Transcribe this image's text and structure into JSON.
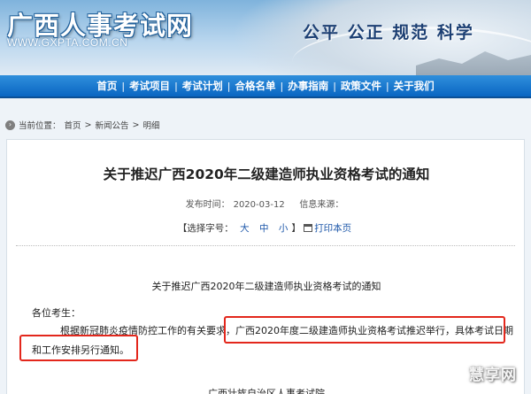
{
  "header": {
    "site_title": "广西人事考试网",
    "site_url": "WWW.GXPTA.COM.CN",
    "slogan": "公平 公正 规范 科学"
  },
  "nav": {
    "items": [
      {
        "label": "首页"
      },
      {
        "label": "考试项目"
      },
      {
        "label": "考试计划"
      },
      {
        "label": "合格名单"
      },
      {
        "label": "办事指南"
      },
      {
        "label": "政策文件"
      },
      {
        "label": "关于我们"
      }
    ],
    "separator": "|"
  },
  "breadcrumb": {
    "prefix": "当前位置：",
    "home": "首页",
    "sep": ">",
    "section": "新闻公告",
    "current": "明细"
  },
  "article": {
    "title": "关于推迟广西2020年二级建造师执业资格考试的通知",
    "publish_label": "发布时间：",
    "publish_date": "2020-03-12",
    "source_label": "信息来源：",
    "source_value": "",
    "font_bracket_open": "【",
    "font_select_label": "选择字号：",
    "font_large": "大",
    "font_medium": "中",
    "font_small": "小",
    "font_bracket_close": "】",
    "print_label": "打印本页",
    "body_heading": "关于推迟广西2020年二级建造师执业资格考试的通知",
    "greeting": "各位考生：",
    "para_line1": "根据新冠肺炎疫情防控工作的有关要求，广西2020年度二级建造师执业资格考试推迟举行，具体考试日期",
    "para_line2": "和工作安排另行通知。",
    "footer_org": "广西壮族自治区人事考试院"
  },
  "watermark": "慧享网",
  "colors": {
    "nav_blue": "#0a66c2",
    "highlight_red": "#e3271c",
    "link_blue": "#1a55a8"
  }
}
